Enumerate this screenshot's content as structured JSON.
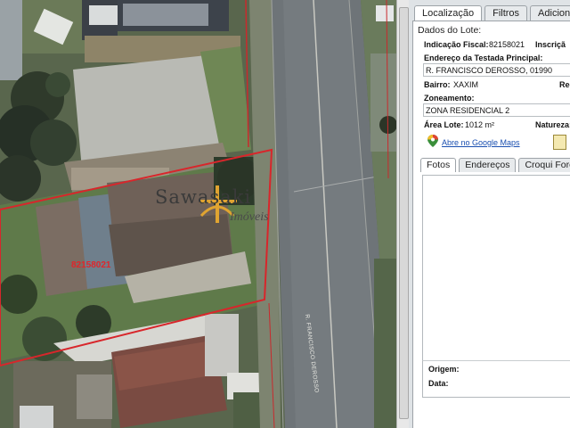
{
  "map": {
    "watermark_brand": "Sawasaki",
    "watermark_sub": "Imóveis",
    "lot_label": "82158021",
    "street_label": "R. FRANCISCO DEROSSO"
  },
  "panel": {
    "tabs": [
      {
        "label": "Localização",
        "active": true
      },
      {
        "label": "Filtros",
        "active": false
      },
      {
        "label": "Adiciona",
        "active": false
      }
    ],
    "section_title": "Dados do Lote:",
    "fields": {
      "indicacao_fiscal_label": "Indicação Fiscal:",
      "indicacao_fiscal_value": "82158021",
      "inscricao_label": "Inscriçã",
      "endereco_label": "Endereço da Testada Principal:",
      "endereco_value": "R. FRANCISCO DEROSSO, 01990",
      "bairro_label": "Bairro:",
      "bairro_value": "XAXIM",
      "reg_label": "Reg",
      "zoneamento_label": "Zoneamento:",
      "zoneamento_value": "ZONA RESIDENCIAL 2",
      "area_lote_label": "Área Lote:",
      "area_lote_value": "1012 m²",
      "natureza_label": "Natureza:"
    },
    "google_maps_link": "Abre no Google Maps",
    "subtabs": [
      {
        "label": "Fotos",
        "active": true
      },
      {
        "label": "Endereços",
        "active": false
      },
      {
        "label": "Croqui Fore",
        "active": false
      }
    ],
    "origem_label": "Origem:",
    "data_label": "Data:"
  },
  "colors": {
    "lot_outline": "#d8262b",
    "watermark": "#3a3a3a",
    "watermark_accent": "#e0a431",
    "lot_label": "#e0262b",
    "link": "#1a4fb0"
  }
}
